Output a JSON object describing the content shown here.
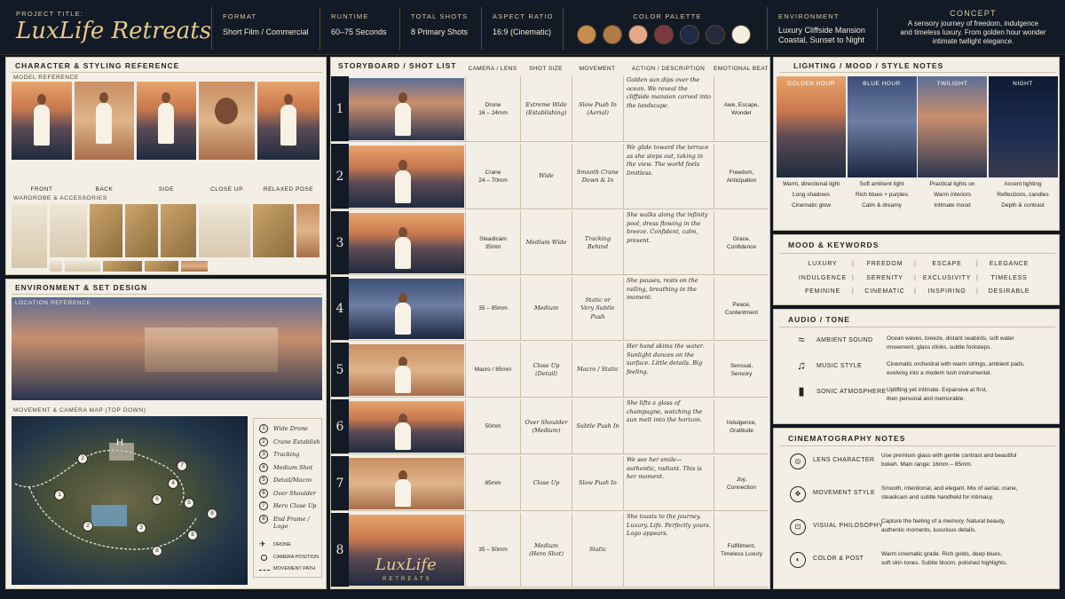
{
  "header": {
    "project_label": "PROJECT TITLE:",
    "project_title": "LuxLife Retreats",
    "format_label": "FORMAT",
    "format_value": "Short Film / Commercial",
    "runtime_label": "RUNTIME",
    "runtime_value": "60–75 Seconds",
    "shots_label": "TOTAL SHOTS",
    "shots_value": "8 Primary Shots",
    "aspect_label": "ASPECT RATIO",
    "aspect_value": "16:9 (Cinematic)",
    "palette_label": "COLOR PALETTE",
    "palette": [
      "#c98c4f",
      "#b07a45",
      "#e6a88a",
      "#7a3a40",
      "#1f2a45",
      "#262a3c",
      "#f5efe3"
    ],
    "environment_label": "ENVIRONMENT",
    "environment_value_1": "Luxury Cliffside Mansion",
    "environment_value_2": "Coastal, Sunset to Night",
    "concept_label": "CONCEPT",
    "concept_text_1": "A sensory journey of freedom, indulgence",
    "concept_text_2": "and timeless luxury. From golden hour wonder",
    "concept_text_3": "intimate twilight elegance."
  },
  "character": {
    "title": "CHARACTER & STYLING REFERENCE",
    "model_label": "MODEL REFERENCE",
    "poses": [
      "FRONT",
      "BACK",
      "SIDE",
      "CLOSE UP",
      "RELAXED POSE"
    ],
    "wardrobe_label": "WARDROBE & ACCESSORIES",
    "accent": "#c9a46a"
  },
  "environment": {
    "title": "ENVIRONMENT & SET DESIGN",
    "location_label": "LOCATION REFERENCE",
    "map_label": "MOVEMENT & CAMERA MAP (TOP DOWN)",
    "map_points": [
      "1",
      "2",
      "3",
      "4",
      "5",
      "6",
      "7",
      "8"
    ],
    "map_marker": "H",
    "legend": [
      {
        "n": "1",
        "label": "Wide Drone"
      },
      {
        "n": "2",
        "label": "Crane Establish"
      },
      {
        "n": "3",
        "label": "Tracking"
      },
      {
        "n": "4",
        "label": "Medium Shot"
      },
      {
        "n": "5",
        "label": "Detail/Macro"
      },
      {
        "n": "6",
        "label": "Over Shoulder"
      },
      {
        "n": "7",
        "label": "Hero Close Up"
      },
      {
        "n": "8",
        "label": "End Frame / Logo"
      }
    ],
    "legend_keys": [
      "DRONE",
      "CAMERA POSITION",
      "MOVEMENT PATH"
    ]
  },
  "storyboard": {
    "title": "STORYBOARD / SHOT LIST",
    "columns": [
      "CAMERA / LENS",
      "SHOT SIZE",
      "MOVEMENT",
      "ACTION / DESCRIPTION",
      "EMOTIONAL BEAT"
    ],
    "logo_1": "LuxLife",
    "logo_2": "RETREATS",
    "rows": [
      {
        "n": "1",
        "cam_1": "Drone",
        "cam_2": "16 – 24mm",
        "size_1": "Extreme Wide",
        "size_2": "(Establishing)",
        "move_1": "Slow Push In",
        "move_2": "(Aerial)",
        "desc": "Golden sun dips over the ocean. We reveal the cliffside mansion carved into the landscape.",
        "beat_1": "Awe, Escape,",
        "beat_2": "Wonder"
      },
      {
        "n": "2",
        "cam_1": "Crane",
        "cam_2": "24 – 70mm",
        "size_1": "Wide",
        "size_2": "",
        "move_1": "Smooth Crane",
        "move_2": "Down & In",
        "desc": "We glide toward the terrace as she steps out, taking in the view. The world feels limitless.",
        "beat_1": "Freedom,",
        "beat_2": "Anticipation"
      },
      {
        "n": "3",
        "cam_1": "Steadicam",
        "cam_2": "35mm",
        "size_1": "Medium Wide",
        "size_2": "",
        "move_1": "Tracking",
        "move_2": "Behind",
        "desc": "She walks along the infinity pool, dress flowing in the breeze. Confident, calm, present.",
        "beat_1": "Grace,",
        "beat_2": "Confidence"
      },
      {
        "n": "4",
        "cam_1": "35 – 85mm",
        "cam_2": "",
        "size_1": "Medium",
        "size_2": "",
        "move_1": "Static or",
        "move_2": "Very Subtle Push",
        "desc": "She pauses, rests on the railing, breathing in the moment.",
        "beat_1": "Peace,",
        "beat_2": "Contentment"
      },
      {
        "n": "5",
        "cam_1": "Macro / 85mm",
        "cam_2": "",
        "size_1": "Close Up",
        "size_2": "(Detail)",
        "move_1": "Macro / Static",
        "move_2": "",
        "desc": "Her hand skims the water. Sunlight dances on the surface. Little details. Big feeling.",
        "beat_1": "Sensual,",
        "beat_2": "Sensory"
      },
      {
        "n": "6",
        "cam_1": "50mm",
        "cam_2": "",
        "size_1": "Over Shoulder",
        "size_2": "(Medium)",
        "move_1": "Subtle Push In",
        "move_2": "",
        "desc": "She lifts a glass of champagne, watching the sun melt into the horizon.",
        "beat_1": "Indulgence,",
        "beat_2": "Gratitude"
      },
      {
        "n": "7",
        "cam_1": "85mm",
        "cam_2": "",
        "size_1": "Close Up",
        "size_2": "",
        "move_1": "Slow Push In",
        "move_2": "",
        "desc": "We see her smile—authentic, radiant. This is her moment.",
        "beat_1": "Joy,",
        "beat_2": "Connection"
      },
      {
        "n": "8",
        "cam_1": "35 – 50mm",
        "cam_2": "",
        "size_1": "Medium",
        "size_2": "(Hero Shot)",
        "move_1": "Static",
        "move_2": "",
        "desc": "She toasts to the journey. Luxury. Life. Perfectly yours. Logo appears.",
        "beat_1": "Fulfillment,",
        "beat_2": "Timeless Luxury"
      }
    ]
  },
  "lighting": {
    "title": "LIGHTING / MOOD / STYLE NOTES",
    "tiles": [
      {
        "label": "GOLDEN HOUR",
        "l1": "Warm, directional light",
        "l2": "Long shadows",
        "l3": "Cinematic glow"
      },
      {
        "label": "BLUE HOUR",
        "l1": "Soft ambient light",
        "l2": "Rich blues + purples",
        "l3": "Calm & dreamy"
      },
      {
        "label": "TWILIGHT",
        "l1": "Practical lights on",
        "l2": "Warm interiors",
        "l3": "Intimate mood"
      },
      {
        "label": "NIGHT",
        "l1": "Accent lighting",
        "l2": "Reflections, candles",
        "l3": "Depth & contrast"
      }
    ]
  },
  "mood": {
    "title": "MOOD & KEYWORDS",
    "separator": "|",
    "row1": [
      "LUXURY",
      "FREEDOM",
      "ESCAPE",
      "ELEGANCE"
    ],
    "row2": [
      "INDULGENCE",
      "SERENITY",
      "EXCLUSIVITY",
      "TIMELESS"
    ],
    "row3": [
      "FEMININE",
      "CINEMATIC",
      "INSPIRING",
      "DESIRABLE"
    ]
  },
  "audio": {
    "title": "AUDIO / TONE",
    "items": [
      {
        "icon": "waves-icon",
        "glyph": "≈",
        "label": "AMBIENT SOUND",
        "l1": "Ocean waves, breeze, distant seabirds, soft water",
        "l2": "movement, glass clinks, subtle footsteps."
      },
      {
        "icon": "music-note-icon",
        "glyph": "♫",
        "label": "MUSIC STYLE",
        "l1": "Cinematic orchestral with warm strings, ambient pads,",
        "l2": "evolving into a modern lush instrumental."
      },
      {
        "icon": "soundwave-icon",
        "glyph": "▮",
        "label": "SONIC ATMOSPHERE",
        "l1": "Uplifting yet intimate. Expansive at first,",
        "l2": "then personal and memorable."
      }
    ]
  },
  "cinematography": {
    "title": "CINEMATOGRAPHY NOTES",
    "items": [
      {
        "icon": "lens-icon",
        "glyph": "◎",
        "label": "LENS CHARACTER",
        "l1": "Use premium glass with gentle contrast and beautiful",
        "l2": "bokeh. Main range: 16mm – 85mm."
      },
      {
        "icon": "movement-icon",
        "glyph": "✥",
        "label": "MOVEMENT STYLE",
        "l1": "Smooth, intentional, and elegant. Mix of aerial, crane,",
        "l2": "steadicam and subtle handheld for intimacy."
      },
      {
        "icon": "frame-icon",
        "glyph": "⊡",
        "label": "VISUAL PHILOSOPHY",
        "l1": "Capture the feeling of a memory. Natural beauty,",
        "l2": "authentic moments, luxurious details."
      },
      {
        "icon": "palette-icon",
        "glyph": "◐",
        "label": "COLOR & POST",
        "l1": "Warm cinematic grade. Rich golds, deep blues,",
        "l2": "soft skin tones. Subtle bloom, polished highlights."
      }
    ]
  }
}
